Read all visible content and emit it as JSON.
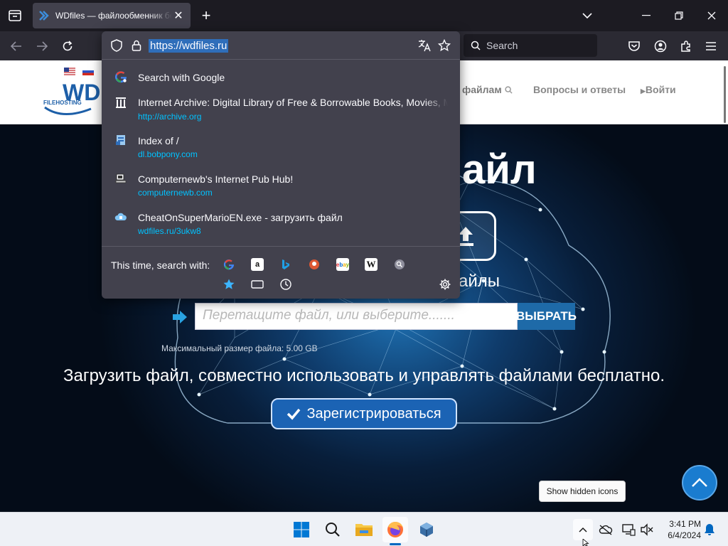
{
  "browser": {
    "tab": {
      "title": "WDfiles — файлообменник бе",
      "close_label": "✕"
    },
    "new_tab_label": "+",
    "url": "https://wdfiles.ru",
    "search_placeholder": "Search"
  },
  "url_dropdown": {
    "results": [
      {
        "title": "Search with Google",
        "url": "",
        "icon": "google-icon"
      },
      {
        "title": "Internet Archive: Digital Library of Free & Borrowable Books, Movies, M",
        "url": "http://archive.org",
        "icon": "archive-icon"
      },
      {
        "title": "Index of /",
        "url": "dl.bobpony.com",
        "icon": "folder-page-icon"
      },
      {
        "title": "Computernewb's Internet Pub Hub!",
        "url": "computernewb.com",
        "icon": "pub-icon"
      },
      {
        "title": "CheatOnSuperMarioEN.exe - загрузить файл",
        "url": "wdfiles.ru/3ukw8",
        "icon": "cloud-icon"
      }
    ],
    "search_with_label": "This time, search with:",
    "engines": [
      "Google",
      "Amazon",
      "Bing",
      "DuckDuckGo",
      "eBay",
      "Wikipedia",
      "Search"
    ]
  },
  "site": {
    "logo_text": "WD",
    "logo_sub": "FILEHOSTING",
    "nav": {
      "files": "файлам",
      "faq": "Вопросы и ответы",
      "login": "Войти"
    },
    "hero_title": "айл",
    "hero_sub": "айлы",
    "drop_placeholder": "Перетащите файл, или выберите.......",
    "choose_button": "ВЫБРАТЬ",
    "max_size": "Максимальный размер файла: 5.00 GB",
    "tagline": "Загрузить файл, совместно использовать и управлять файлами бесплатно.",
    "register_button": "Зарегистрироваться"
  },
  "taskbar": {
    "tooltip": "Show hidden icons",
    "time": "3:41 PM",
    "date": "6/4/2024"
  },
  "colors": {
    "chrome_dark": "#1c1b22",
    "panel": "#42414d",
    "url_link": "#00c2ff",
    "accent": "#0067c0"
  }
}
